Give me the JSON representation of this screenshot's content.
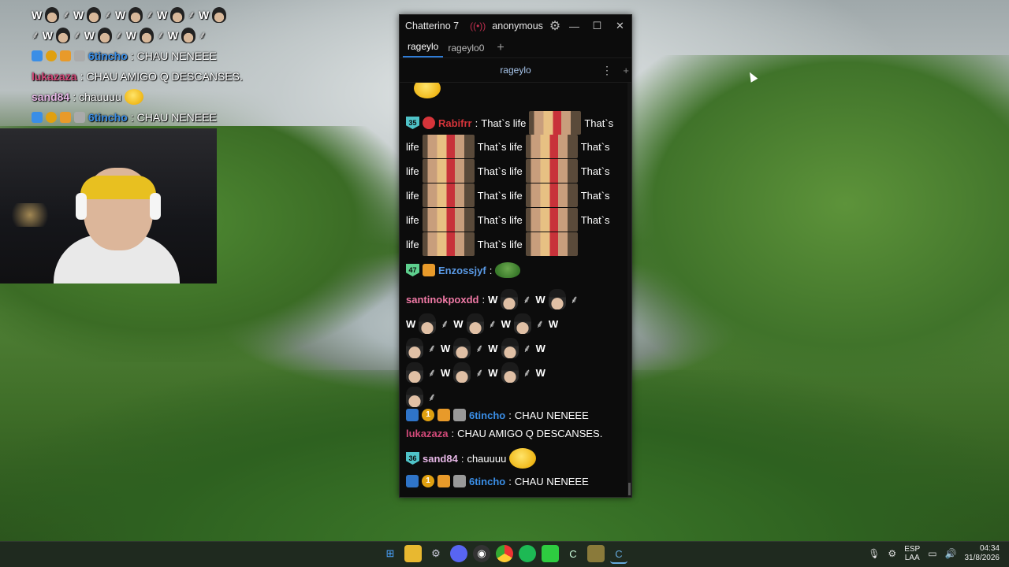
{
  "overlay_chat": {
    "lines": [
      {
        "kind": "emote-row",
        "text": "W"
      },
      {
        "kind": "emote-row",
        "text": "W"
      },
      {
        "kind": "msg",
        "name": "6tincho",
        "name_color": "#3a8ee6",
        "sep": ":",
        "text": "CHAU NENEEE"
      },
      {
        "kind": "msg",
        "name": "lukazaza",
        "name_color": "#d44a7a",
        "sep": ":",
        "text": "CHAU AMIGO Q DESCANSES."
      },
      {
        "kind": "msg",
        "name": "sand84",
        "name_color": "#e6b7e6",
        "sep": ":",
        "text": "chauuuu"
      },
      {
        "kind": "msg",
        "name": "6tincho",
        "name_color": "#3a8ee6",
        "sep": ":",
        "text": "CHAU NENEEE"
      }
    ]
  },
  "window": {
    "title": "Chatterino 7",
    "user": "anonymous",
    "icons": {
      "live": "live-icon",
      "settings": "gear-icon",
      "minimize": "minimize-icon",
      "maximize": "maximize-icon",
      "close": "close-icon"
    },
    "tabs": [
      {
        "label": "rageylo",
        "active": true
      },
      {
        "label": "rageylo0",
        "active": false
      }
    ],
    "split_title": "rageylo"
  },
  "chat": {
    "rabifrr": {
      "badge": "35",
      "badge_color": "#4fc3c8",
      "name": "Rabifrr",
      "name_color": "#d6343a",
      "sep": ":",
      "text": "That`s life"
    },
    "rabifrr_words": {
      "thats": "That`s",
      "life": "life",
      "full": "That`s life"
    },
    "enzo": {
      "badge": "47",
      "badge_color": "#5ed08e",
      "name": "Enzossjyf",
      "name_color": "#5a9ae6",
      "sep": ":"
    },
    "santi": {
      "name": "santinokpoxdd",
      "name_color": "#f07aa6",
      "sep": ":",
      "w": "W"
    },
    "tincho1": {
      "badge_round": "1",
      "name": "6tincho",
      "name_color": "#3a8ee6",
      "sep": ":",
      "text": "CHAU NENEEE"
    },
    "luka": {
      "name": "lukazaza",
      "name_color": "#d44a7a",
      "sep": ":",
      "text": "CHAU AMIGO Q DESCANSES."
    },
    "sand": {
      "badge": "36",
      "badge_color": "#4fc3c8",
      "name": "sand84",
      "name_color": "#e6b7e6",
      "sep": ":",
      "text": "chauuuu"
    },
    "tincho2": {
      "badge_round": "1",
      "name": "6tincho",
      "name_color": "#3a8ee6",
      "sep": ":",
      "text": "CHAU NENEEE"
    }
  },
  "taskbar": {
    "apps": [
      "windows-start-icon",
      "file-explorer-icon",
      "steam-icon",
      "discord-icon",
      "obs-icon",
      "chrome-icon",
      "spotify-icon",
      "green-app-icon",
      "ccleaner-icon",
      "game-app-icon",
      "chatterino-icon"
    ],
    "lang_top": "ESP",
    "lang_bottom": "LAA",
    "time": "04:34",
    "date": "31/8/2026"
  }
}
